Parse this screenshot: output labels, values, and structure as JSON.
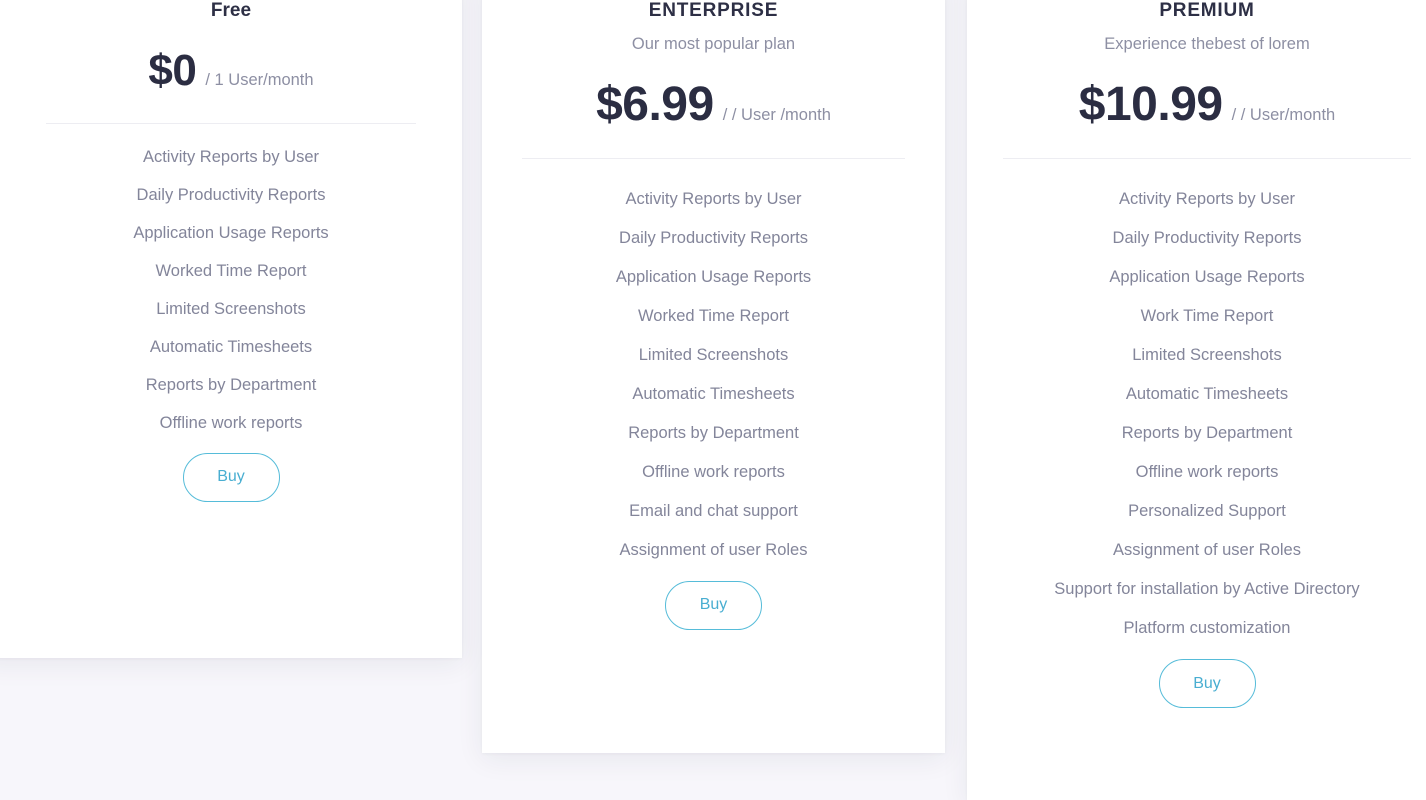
{
  "page": {
    "background_color": "#f7f6fb",
    "card_background": "#ffffff"
  },
  "theme": {
    "heading_color": "#2d2f45",
    "price_color": "#2b2d42",
    "muted_color": "#8d8fa3",
    "feature_color": "#83859a",
    "accent_color": "#49aed1",
    "button_border_color": "#56bcd9",
    "divider_color": "#ededf2"
  },
  "plans": [
    {
      "name": "Free",
      "subtitle": "",
      "price": "$0",
      "period": "/ 1 User/month",
      "features": [
        "Activity Reports by User",
        "Daily Productivity Reports",
        "Application Usage Reports",
        "Worked Time Report",
        "Limited Screenshots",
        "Automatic Timesheets",
        "Reports by Department",
        "Offline work reports"
      ],
      "cta_label": "Buy"
    },
    {
      "name": "ENTERPRISE",
      "subtitle": "Our most popular plan",
      "price": "$6.99",
      "period": "/ / User /month",
      "features": [
        "Activity Reports by User",
        "Daily Productivity Reports",
        "Application Usage Reports",
        "Worked Time Report",
        "Limited Screenshots",
        "Automatic Timesheets",
        "Reports by Department",
        "Offline work reports",
        "Email and chat support",
        "Assignment of user Roles"
      ],
      "cta_label": "Buy"
    },
    {
      "name": "PREMIUM",
      "subtitle": "Experience thebest of lorem",
      "price": "$10.99",
      "period": "/ / User/month",
      "features": [
        "Activity Reports by User",
        "Daily Productivity Reports",
        "Application Usage Reports",
        "Work Time Report",
        "Limited Screenshots",
        "Automatic Timesheets",
        "Reports by Department",
        "Offline work reports",
        "Personalized Support",
        "Assignment of user Roles",
        "Support for installation by Active Directory",
        "Platform customization"
      ],
      "cta_label": "Buy"
    }
  ]
}
